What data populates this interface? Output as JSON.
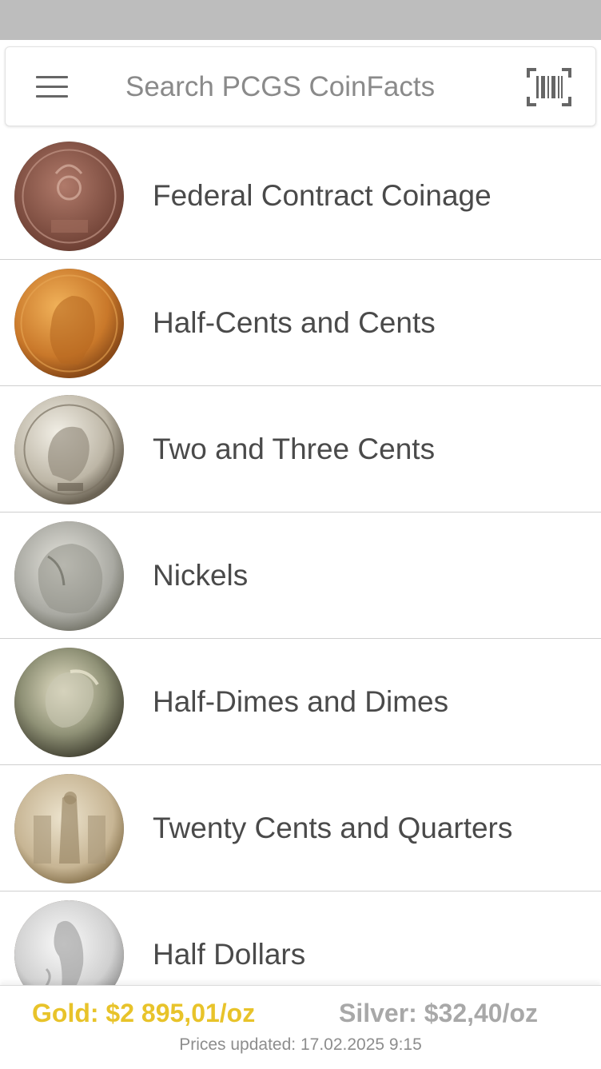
{
  "search": {
    "placeholder": "Search PCGS CoinFacts",
    "value": ""
  },
  "icons": {
    "menu": "hamburger-menu-icon",
    "scan": "barcode-scan-icon"
  },
  "categories": [
    {
      "label": "Federal Contract Coinage",
      "coin": "fugio-cent-icon",
      "color": "#8e5a4a"
    },
    {
      "label": "Half-Cents and Cents",
      "coin": "lincoln-cent-icon",
      "color": "#c9782a"
    },
    {
      "label": "Two and Three Cents",
      "coin": "three-cent-nickel-icon",
      "color": "#b9b3a6"
    },
    {
      "label": "Nickels",
      "coin": "buffalo-nickel-icon",
      "color": "#a9a9a2"
    },
    {
      "label": "Half-Dimes and Dimes",
      "coin": "mercury-dime-icon",
      "color": "#8f9176"
    },
    {
      "label": "Twenty Cents and Quarters",
      "coin": "standing-liberty-quarter-icon",
      "color": "#c7b594"
    },
    {
      "label": "Half Dollars",
      "coin": "walking-liberty-half-icon",
      "color": "#d0d0d0"
    }
  ],
  "prices": {
    "gold": "Gold: $2 895,01/oz",
    "silver": "Silver: $32,40/oz",
    "updated": "Prices updated: 17.02.2025 9:15",
    "gold_color": "#e8c32a",
    "silver_color": "#a8a8a8"
  }
}
